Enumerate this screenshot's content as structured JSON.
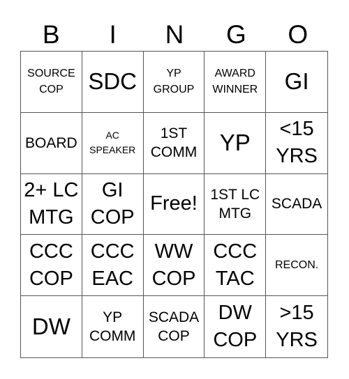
{
  "header": {
    "letters": [
      "B",
      "I",
      "N",
      "G",
      "O"
    ]
  },
  "grid": {
    "rows": [
      [
        {
          "text": "SOURCE\nCOP",
          "size": "sm"
        },
        {
          "text": "SDC",
          "size": "xl"
        },
        {
          "text": "YP\nGROUP",
          "size": "sm"
        },
        {
          "text": "AWARD\nWINNER",
          "size": "sm"
        },
        {
          "text": "GI",
          "size": "xl"
        }
      ],
      [
        {
          "text": "BOARD",
          "size": "md"
        },
        {
          "text": "AC\nSPEAKER",
          "size": "xs"
        },
        {
          "text": "1ST\nCOMM",
          "size": "md"
        },
        {
          "text": "YP",
          "size": "xl"
        },
        {
          "text": "<15\nYRS",
          "size": "lg"
        }
      ],
      [
        {
          "text": "2+ LC\nMTG",
          "size": "lg"
        },
        {
          "text": "GI\nCOP",
          "size": "lg"
        },
        {
          "text": "Free!",
          "size": "lg"
        },
        {
          "text": "1ST LC\nMTG",
          "size": "md"
        },
        {
          "text": "SCADA",
          "size": "md"
        }
      ],
      [
        {
          "text": "CCC\nCOP",
          "size": "lg"
        },
        {
          "text": "CCC\nEAC",
          "size": "lg"
        },
        {
          "text": "WW\nCOP",
          "size": "lg"
        },
        {
          "text": "CCC\nTAC",
          "size": "lg"
        },
        {
          "text": "RECON.",
          "size": "sm"
        }
      ],
      [
        {
          "text": "DW",
          "size": "xl"
        },
        {
          "text": "YP\nCOMM",
          "size": "md"
        },
        {
          "text": "SCADA\nCOP",
          "size": "md"
        },
        {
          "text": "DW\nCOP",
          "size": "lg"
        },
        {
          "text": ">15\nYRS",
          "size": "lg"
        }
      ]
    ]
  }
}
